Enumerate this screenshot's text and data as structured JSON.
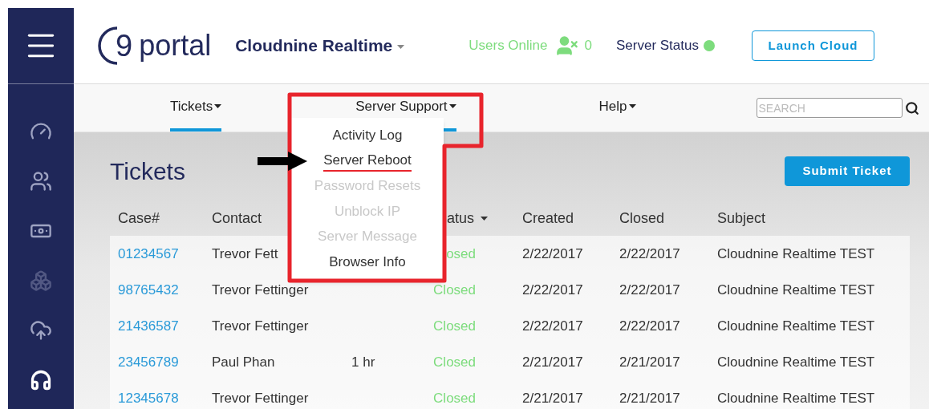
{
  "sidebar": {
    "items": [
      {
        "kind": "gauge",
        "active": false,
        "disabled": false
      },
      {
        "kind": "users",
        "active": false,
        "disabled": false
      },
      {
        "kind": "money",
        "active": false,
        "disabled": false
      },
      {
        "kind": "cubes",
        "active": false,
        "disabled": true
      },
      {
        "kind": "cloud",
        "active": false,
        "disabled": false
      },
      {
        "kind": "headset",
        "active": true,
        "disabled": false
      }
    ]
  },
  "header": {
    "logo": {
      "mark": "9",
      "word": "portal"
    },
    "account": "Cloudnine Realtime",
    "users_online": {
      "label": "Users Online",
      "count": "0"
    },
    "server_status": {
      "label": "Server Status"
    },
    "launch_button": "Launch Cloud"
  },
  "nav": {
    "tabs": [
      {
        "label": "Tickets",
        "selected": true
      },
      {
        "label": "Server Support",
        "selected": true
      },
      {
        "label": "Help",
        "selected": false
      }
    ],
    "search": {
      "placeholder": "SEARCH"
    }
  },
  "dropdown": {
    "items": [
      {
        "label": "Activity Log",
        "disabled": false,
        "highlighted": false
      },
      {
        "label": "Server Reboot",
        "disabled": false,
        "highlighted": true
      },
      {
        "label": "Password Resets",
        "disabled": true,
        "highlighted": false
      },
      {
        "label": "Unblock IP",
        "disabled": true,
        "highlighted": false
      },
      {
        "label": "Server Message",
        "disabled": true,
        "highlighted": false
      },
      {
        "label": "Browser Info",
        "disabled": false,
        "highlighted": false
      }
    ]
  },
  "page": {
    "title": "Tickets",
    "submit_button": "Submit Ticket"
  },
  "table": {
    "header": {
      "case": "Case#",
      "contact": "Contact",
      "status": "atus",
      "created": "Created",
      "closed": "Closed",
      "subject": "Subject"
    },
    "rows": [
      {
        "case": "01234567",
        "contact": "Trevor Fett",
        "status": "osed",
        "created": "2/22/2017",
        "closed": "2/22/2017",
        "subject": "Cloudnine Realtime TEST"
      },
      {
        "case": "98765432",
        "contact": "Trevor Fettinger",
        "status": "Closed",
        "created": "2/22/2017",
        "closed": "2/22/2017",
        "subject": "Cloudnine Realtime TEST"
      },
      {
        "case": "21436587",
        "contact": "Trevor Fettinger",
        "status": "Closed",
        "created": "2/22/2017",
        "closed": "2/22/2017",
        "subject": "Cloudnine Realtime TEST"
      },
      {
        "case": "23456789",
        "contact": "Paul Phan",
        "column_3": "1 hr",
        "status": "Closed",
        "created": "2/21/2017",
        "closed": "2/21/2017",
        "subject": "Cloudnine Realtime TEST"
      },
      {
        "case": "12345678",
        "contact": "Trevor Fettinger",
        "status": "Closed",
        "created": "2/21/2017",
        "closed": "2/21/2017",
        "subject": "Cloudnine Realtime TEST"
      }
    ]
  }
}
